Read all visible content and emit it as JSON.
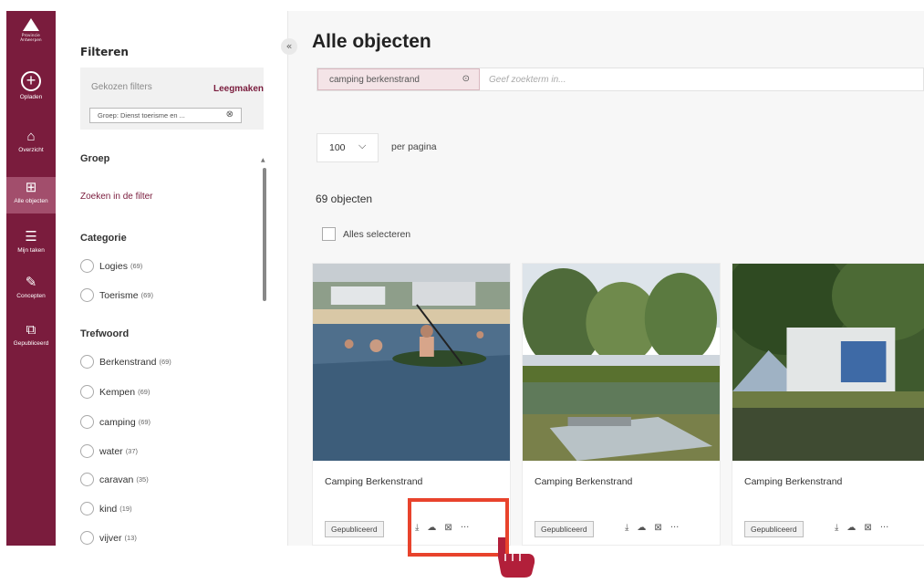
{
  "rail": {
    "logo_text": "Provincie Antwerpen",
    "items": [
      {
        "label": "Opladen",
        "icon": "upload-plus-icon"
      },
      {
        "label": "Overzicht",
        "icon": "home-icon"
      },
      {
        "label": "Alle objecten",
        "icon": "grid-icon"
      },
      {
        "label": "Mijn taken",
        "icon": "tasks-icon"
      },
      {
        "label": "Concepten",
        "icon": "pencil-icon"
      },
      {
        "label": "Gepubliceerd",
        "icon": "published-icon"
      }
    ]
  },
  "filters": {
    "title": "Filteren",
    "chosen_label": "Gekozen filters",
    "clear_label": "Leegmaken",
    "chosen_chip": "Groep: Dienst toerisme en ...",
    "group_title": "Groep",
    "group_search": "Zoeken in de filter",
    "category_title": "Categorie",
    "categories": [
      {
        "label": "Logies",
        "count": "(69)"
      },
      {
        "label": "Toerisme",
        "count": "(69)"
      }
    ],
    "keyword_title": "Trefwoord",
    "keywords": [
      {
        "label": "Berkenstrand",
        "count": "(69)"
      },
      {
        "label": "Kempen",
        "count": "(69)"
      },
      {
        "label": "camping",
        "count": "(69)"
      },
      {
        "label": "water",
        "count": "(37)"
      },
      {
        "label": "caravan",
        "count": "(35)"
      },
      {
        "label": "kind",
        "count": "(19)"
      },
      {
        "label": "vijver",
        "count": "(13)"
      }
    ]
  },
  "main": {
    "title": "Alle objecten",
    "search_tag": "camping berkenstrand",
    "search_placeholder": "Geef zoekterm in...",
    "per_page_value": "100",
    "per_page_label": "per pagina",
    "count": "69 objecten",
    "select_all": "Alles selecteren",
    "cards": [
      {
        "name": "Camping Berkenstrand",
        "status": "Gepubliceerd"
      },
      {
        "name": "Camping Berkenstrand",
        "status": "Gepubliceerd"
      },
      {
        "name": "Camping Berkenstrand",
        "status": "Gepubliceerd"
      }
    ]
  },
  "colors": {
    "brand": "#7a1c3d",
    "highlight": "#e8432c"
  }
}
